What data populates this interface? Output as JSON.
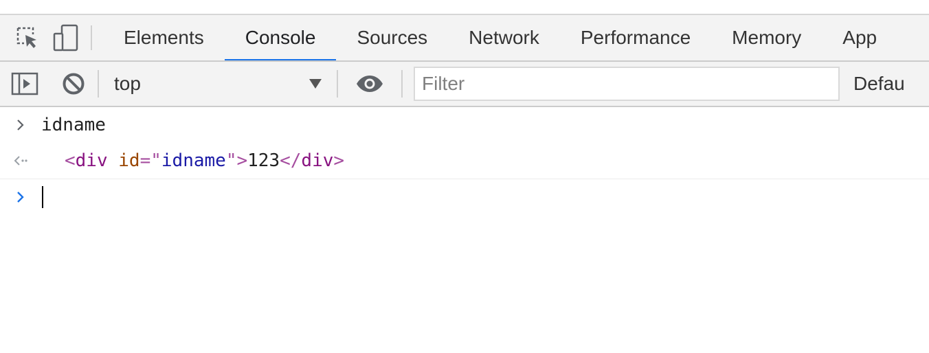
{
  "tabbar": {
    "tabs": [
      {
        "label": "Elements"
      },
      {
        "label": "Console"
      },
      {
        "label": "Sources"
      },
      {
        "label": "Network"
      },
      {
        "label": "Performance"
      },
      {
        "label": "Memory"
      },
      {
        "label": "App"
      }
    ],
    "active_tab": "Console",
    "icons": [
      "inspect-element-icon",
      "device-toolbar-icon"
    ]
  },
  "toolbar": {
    "context": "top",
    "filter_placeholder": "Filter",
    "filter_value": "",
    "levels_label": "Defau",
    "icons": [
      "sidebar-toggle-icon",
      "clear-console-icon",
      "live-expression-eye-icon"
    ]
  },
  "console": {
    "input_command": "idname",
    "result": {
      "tag": "div",
      "attr_name": "id",
      "attr_value": "idname",
      "text": "123",
      "open_lt": "<",
      "equals_quote": "=\"",
      "close_quote_gt": "\">",
      "close_lt_slash": "</",
      "close_gt": ">"
    },
    "prompt_value": ""
  },
  "colors": {
    "accent": "#1a73e8",
    "toolbar_bg": "#f3f3f3",
    "tag": "#881280",
    "attr_name": "#994500",
    "attr_value": "#1a1aa6"
  }
}
